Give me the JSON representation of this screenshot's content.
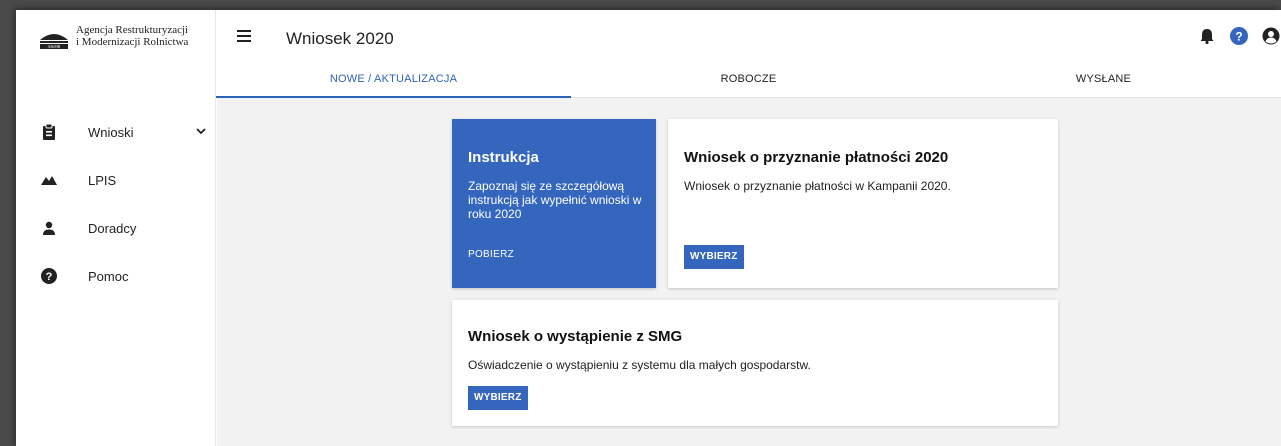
{
  "logo": {
    "line1": "Agencja Restrukturyzacji",
    "line2": "i Modernizacji Rolnictwa"
  },
  "sidebar": {
    "items": [
      {
        "label": "Wnioski",
        "icon": "clipboard-icon"
      },
      {
        "label": "LPIS",
        "icon": "mountains-icon"
      },
      {
        "label": "Doradcy",
        "icon": "person-icon"
      },
      {
        "label": "Pomoc",
        "icon": "help-circle-icon"
      }
    ]
  },
  "header": {
    "title": "Wniosek 2020",
    "icons": [
      "bell-icon",
      "help-icon",
      "account-icon"
    ]
  },
  "tabs": [
    {
      "label": "NOWE / AKTUALIZACJA",
      "active": true
    },
    {
      "label": "ROBOCZE",
      "active": false
    },
    {
      "label": "WYSŁANE",
      "active": false
    }
  ],
  "cards": {
    "instruction": {
      "title": "Instrukcja",
      "text": "Zapoznaj się ze szczegółową instrukcją jak wypełnić wnioski w roku 2020",
      "action": "POBIERZ"
    },
    "payment": {
      "title": "Wniosek o przyznanie płatności 2020",
      "text": "Wniosek o przyznanie płatności w Kampanii 2020.",
      "action": "WYBIERZ"
    },
    "smg": {
      "title": "Wniosek o wystąpienie z SMG",
      "text": "Oświadczenie o wystąpieniu z systemu dla małych gospodarstw.",
      "action": "WYBIERZ"
    }
  },
  "colors": {
    "accent": "#3466bd",
    "background": "#f2f2f2"
  }
}
